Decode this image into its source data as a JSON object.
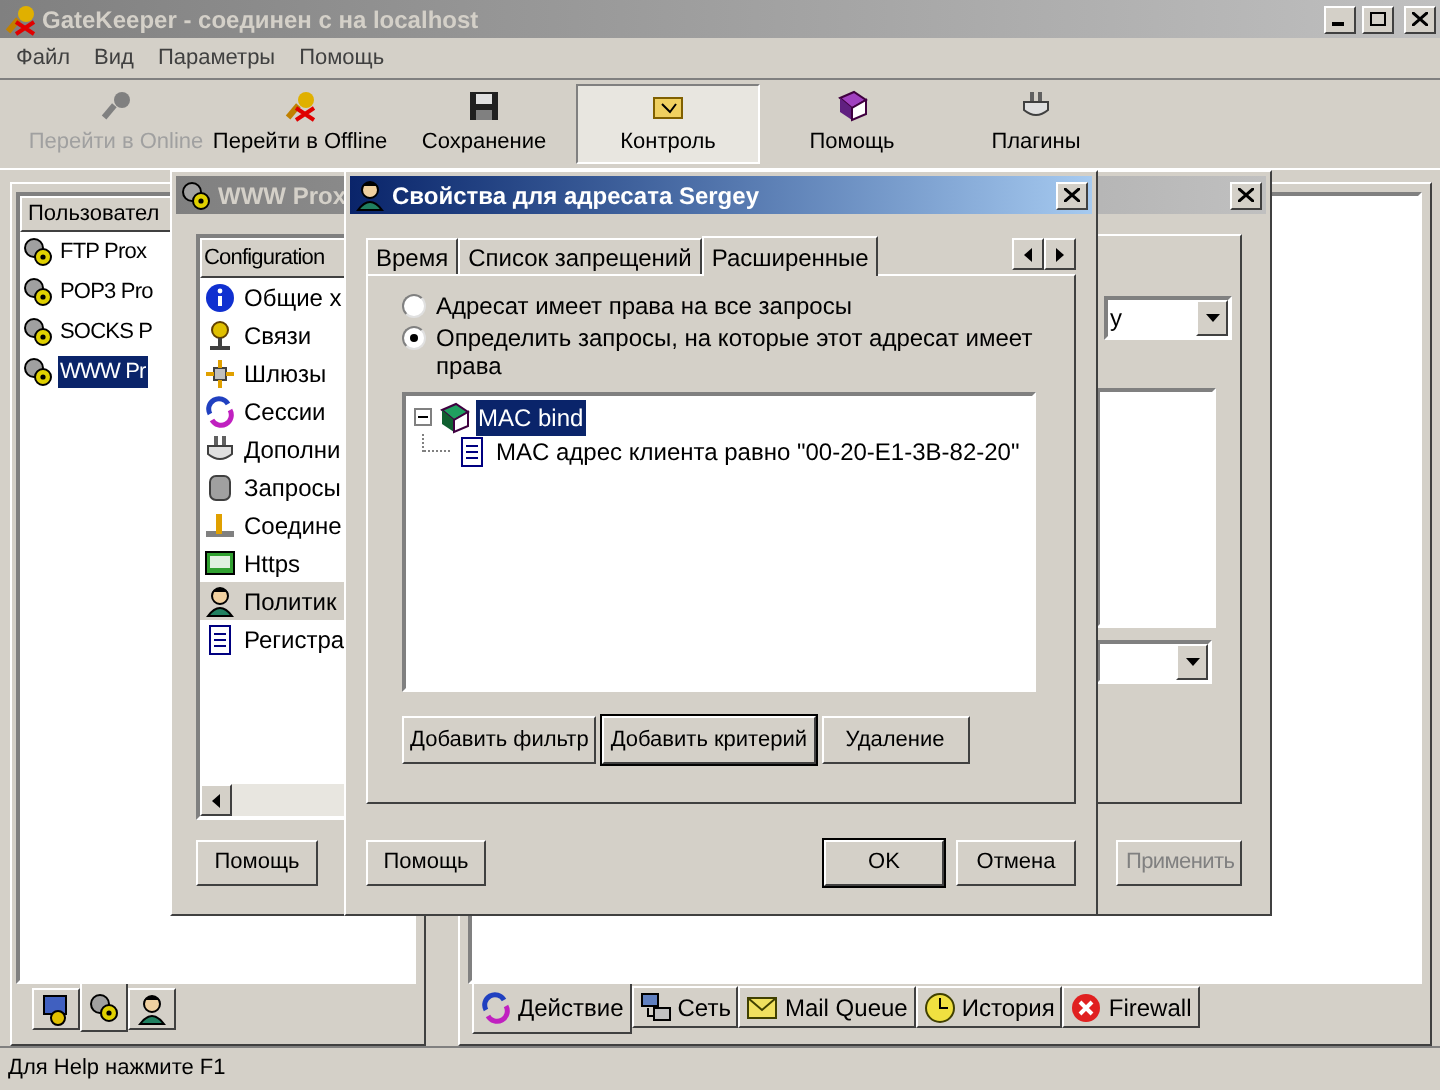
{
  "window": {
    "title": "GateKeeper - соединен с на localhost"
  },
  "menu": [
    "Файл",
    "Вид",
    "Параметры",
    "Помощь"
  ],
  "toolbar": [
    {
      "label": "Перейти в Online",
      "kind": "key",
      "disabled": true,
      "selected": false
    },
    {
      "label": "Перейти в Offline",
      "kind": "key-off",
      "disabled": false,
      "selected": false
    },
    {
      "label": "Сохранение",
      "kind": "disk",
      "disabled": false,
      "selected": false
    },
    {
      "label": "Контроль",
      "kind": "folder",
      "disabled": false,
      "selected": true
    },
    {
      "label": "Помощь",
      "kind": "book",
      "disabled": false,
      "selected": false
    },
    {
      "label": "Плагины",
      "kind": "plug",
      "disabled": false,
      "selected": false
    }
  ],
  "users_panel": {
    "header": "Пользовател",
    "items": [
      {
        "label": "FTP Prox",
        "selected": false
      },
      {
        "label": "POP3 Pro",
        "selected": false
      },
      {
        "label": "SOCKS P",
        "selected": false
      },
      {
        "label": "WWW Pr",
        "selected": true
      }
    ],
    "tabs": [
      {
        "kind": "server",
        "selected": false
      },
      {
        "kind": "gears",
        "selected": true
      },
      {
        "kind": "user",
        "selected": false
      }
    ]
  },
  "log_panel": {
    "tabs": [
      {
        "label": "Действие",
        "kind": "action",
        "selected": true
      },
      {
        "label": "Сеть",
        "kind": "network",
        "selected": false
      },
      {
        "label": "Mail Queue",
        "kind": "mail",
        "selected": false
      },
      {
        "label": "История",
        "kind": "history",
        "selected": false
      },
      {
        "label": "Firewall",
        "kind": "firewall",
        "selected": false
      }
    ]
  },
  "proxy_dialog": {
    "title": "WWW Prox",
    "list_header": "Configuration",
    "items": [
      {
        "label": "Общие х",
        "kind": "info",
        "selected": false
      },
      {
        "label": "Связи",
        "kind": "link",
        "selected": false
      },
      {
        "label": "Шлюзы",
        "kind": "gateway",
        "selected": false
      },
      {
        "label": "Сессии",
        "kind": "session",
        "selected": false
      },
      {
        "label": "Дополни",
        "kind": "plug",
        "selected": false
      },
      {
        "label": "Запросы",
        "kind": "cube",
        "selected": false
      },
      {
        "label": "Соедине",
        "kind": "connection",
        "selected": false
      },
      {
        "label": "Https",
        "kind": "https",
        "selected": false
      },
      {
        "label": "Политик",
        "kind": "user",
        "selected": true
      },
      {
        "label": "Регистра",
        "kind": "document",
        "selected": false
      }
    ],
    "dropdown_value": "y",
    "help_button": {
      "label": "Помощь",
      "disabled": false
    },
    "apply_button": {
      "label": "Применить",
      "disabled": true
    }
  },
  "properties_dialog": {
    "title": "Свойства для адресата Sergey",
    "tabs": [
      {
        "label": "Время",
        "selected": false
      },
      {
        "label": "Список запрещений",
        "selected": false
      },
      {
        "label": "Расширенные",
        "selected": true
      }
    ],
    "radios": [
      {
        "label": "Адресат имеет права на все запросы",
        "selected": false
      },
      {
        "label": "Определить запросы, на которые этот адресат имеет права",
        "selected": true
      }
    ],
    "tree": [
      {
        "label": "MAC bind",
        "selected": true,
        "expanded": true,
        "children": [
          {
            "label": "MAC адрес клиента равно \"00-20-E1-3B-82-20\"",
            "selected": false
          }
        ]
      }
    ],
    "action_buttons": [
      {
        "label": "Добавить фильтр",
        "focused": false
      },
      {
        "label": "Добавить критерий",
        "focused": true
      },
      {
        "label": "Удаление",
        "focused": false
      }
    ],
    "buttons": [
      {
        "label": "Помощь",
        "default": false
      },
      {
        "label": "OK",
        "default": true
      },
      {
        "label": "Отмена",
        "default": false
      }
    ]
  },
  "status_bar": "Для Help нажмите F1"
}
